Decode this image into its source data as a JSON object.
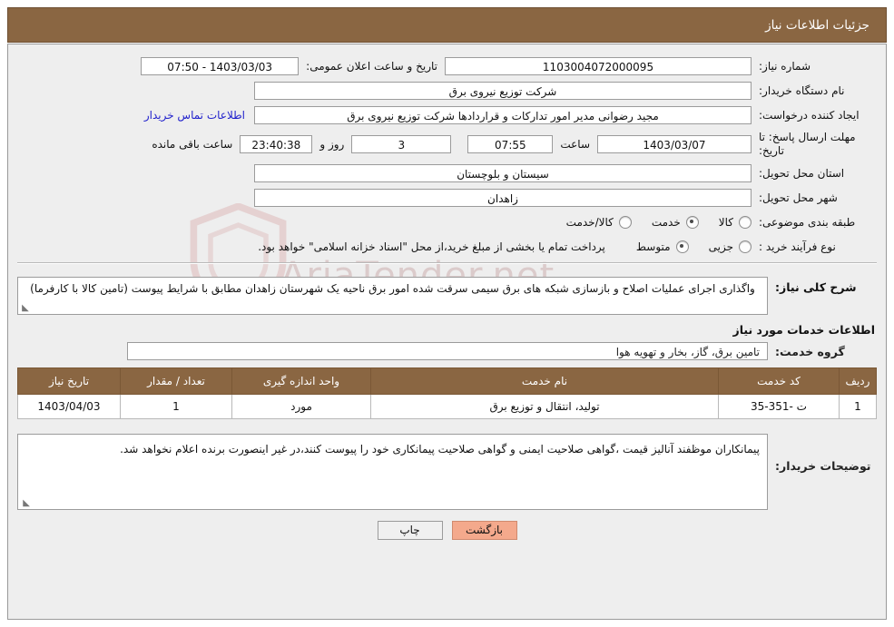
{
  "header": {
    "title": "جزئیات اطلاعات نیاز"
  },
  "form": {
    "need_no_label": "شماره نیاز:",
    "need_no_value": "1103004072000095",
    "public_announce_label": "تاریخ و ساعت اعلان عمومی:",
    "public_announce_value": "1403/03/03 - 07:50",
    "buyer_org_label": "نام دستگاه خریدار:",
    "buyer_org_value": "شرکت توزیع نیروی برق",
    "creator_label": "ایجاد کننده درخواست:",
    "creator_value": "مجید  رضوانی مدیر امور تدارکات و قراردادها شرکت توزیع نیروی برق",
    "contact_link": "اطلاعات تماس خریدار",
    "deadline_label": "مهلت ارسال پاسخ: تا تاریخ:",
    "deadline_date": "1403/03/07",
    "hour_label": "ساعت",
    "deadline_hour": "07:55",
    "days_value": "3",
    "days_unit_label": "روز و",
    "timer_value": "23:40:38",
    "remaining_label": "ساعت باقی مانده",
    "province_label": "استان محل تحویل:",
    "province_value": "سیستان و بلوچستان",
    "city_label": "شهر محل تحویل:",
    "city_value": "زاهدان",
    "category_label": "طبقه بندی موضوعی:",
    "category_options": [
      {
        "label": "کالا",
        "selected": false
      },
      {
        "label": "خدمت",
        "selected": true
      },
      {
        "label": "کالا/خدمت",
        "selected": false
      }
    ],
    "process_label": "نوع فرآیند خرید :",
    "process_options": [
      {
        "label": "جزیی",
        "selected": false
      },
      {
        "label": "متوسط",
        "selected": true
      }
    ],
    "process_note": "پرداخت تمام یا بخشی از مبلغ خرید،از محل \"اسناد خزانه اسلامی\" خواهد بود."
  },
  "description": {
    "label": "شرح کلی نیاز:",
    "text": "واگذاری اجرای عملیات اصلاح و بازسازی شبکه های برق سیمی سرقت شده امور برق ناحیه یک شهرستان زاهدان مطابق با شرایط پیوست (تامین کالا با کارفرما)"
  },
  "services": {
    "section_title": "اطلاعات خدمات مورد نیاز",
    "group_label": "گروه خدمت:",
    "group_value": "تامین برق، گاز، بخار و تهویه هوا",
    "table": {
      "columns": [
        "ردیف",
        "کد خدمت",
        "نام خدمت",
        "واحد اندازه گیری",
        "تعداد / مقدار",
        "تاریخ نیاز"
      ],
      "rows": [
        {
          "row": "1",
          "code": "ت -351-35",
          "name": "تولید، انتقال و توزیع برق",
          "unit": "مورد",
          "qty": "1",
          "date": "1403/04/03"
        }
      ]
    }
  },
  "comments": {
    "label": "توضیحات خریدار:",
    "text": "پیمانکاران موظفند آنالیز قیمت ،گواهی صلاحیت ایمنی و گواهی صلاحیت پیمانکاری خود را پیوست کنند،در غیر اینصورت برنده اعلام نخواهد شد."
  },
  "footer": {
    "print_label": "چاپ",
    "back_label": "بازگشت"
  },
  "watermark": {
    "text": "AriaTender.net"
  }
}
